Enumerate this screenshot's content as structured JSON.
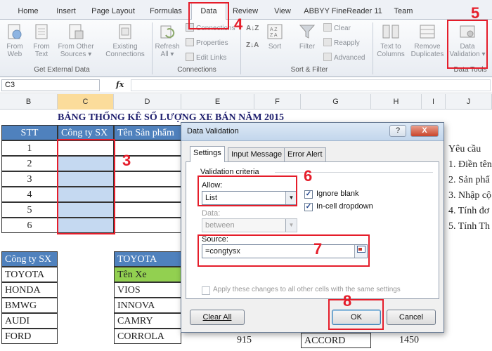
{
  "ribbon_tabs": [
    "Home",
    "Insert",
    "Page Layout",
    "Formulas",
    "Data",
    "Review",
    "View",
    "ABBYY FineReader 11",
    "Team"
  ],
  "ribbon": {
    "from_web": [
      "From",
      "Web"
    ],
    "from_text": [
      "From",
      "Text"
    ],
    "from_other": [
      "From Other",
      "Sources ▾"
    ],
    "existing": [
      "Existing",
      "Connections"
    ],
    "group_external": "Get External Data",
    "refresh": [
      "Refresh",
      "All ▾"
    ],
    "connections": "Connections",
    "properties": "Properties",
    "edit_links": "Edit Links",
    "group_connections": "Connections",
    "sort": "Sort",
    "filter": "Filter",
    "clear": "Clear",
    "reapply": "Reapply",
    "advanced": "Advanced",
    "group_sort": "Sort & Filter",
    "text_to_columns": [
      "Text to",
      "Columns"
    ],
    "remove_duplicates": [
      "Remove",
      "Duplicates"
    ],
    "data_validation": [
      "Data",
      "Validation ▾"
    ],
    "group_tools": "Data Tools"
  },
  "formula_bar": {
    "name_box": "C3",
    "fx": "fx",
    "content": ""
  },
  "columns": [
    "B",
    "C",
    "D",
    "E",
    "F",
    "G",
    "H",
    "I",
    "J"
  ],
  "sheet": {
    "title": "BẢNG THỐNG KÊ SỐ LƯỢNG XE BÁN NĂM 2015",
    "header_stt": "STT",
    "header_company": "Công ty SX",
    "header_product": "Tên Sản phẩm",
    "stt": [
      "1",
      "2",
      "3",
      "4",
      "5",
      "6"
    ],
    "notes_title": "Yêu cầu",
    "notes": [
      "1. Điền tên",
      "2. Sản phẩ",
      "3. Nhập cộ",
      "4. Tính đơ",
      "5. Tính Th"
    ],
    "lookup_header": "Công ty SX",
    "lookup": [
      "TOYOTA",
      "HONDA",
      "BMWG",
      "AUDI",
      "FORD"
    ],
    "toyota_header": "TOYOTA",
    "car_header": "Tên Xe",
    "cars": [
      "VIOS",
      "INNOVA",
      "CAMRY",
      "CORROLA"
    ],
    "e_last": "915",
    "g_last": "ACCORD",
    "h_last": "1450"
  },
  "dialog": {
    "title": "Data Validation",
    "help": "?",
    "close": "X",
    "tabs": [
      "Settings",
      "Input Message",
      "Error Alert"
    ],
    "criteria": "Validation criteria",
    "allow_label": "Allow:",
    "allow_value": "List",
    "ignore_blank": "Ignore blank",
    "in_cell_dropdown": "In-cell dropdown",
    "data_label": "Data:",
    "data_value": "between",
    "source_label": "Source:",
    "source_value": "=congtysx",
    "apply_all": "Apply these changes to all other cells with the same settings",
    "clear_all": "Clear All",
    "ok": "OK",
    "cancel": "Cancel"
  },
  "annotations": [
    "3",
    "4",
    "5",
    "6",
    "7",
    "8"
  ]
}
